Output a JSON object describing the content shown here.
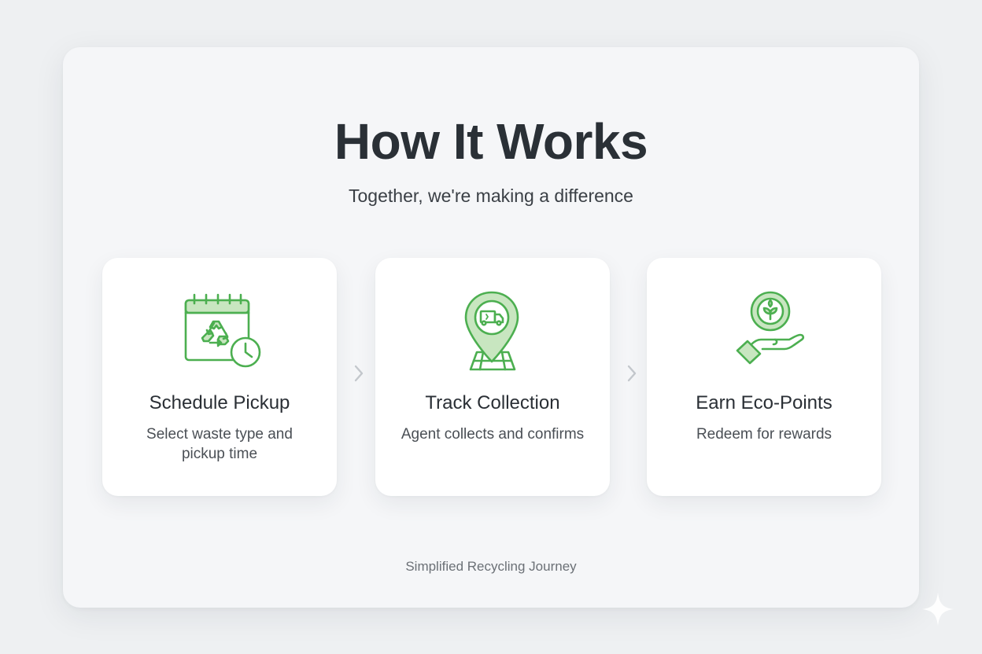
{
  "header": {
    "title": "How It Works",
    "subtitle": "Together, we're making a difference"
  },
  "steps": [
    {
      "title": "Schedule Pickup",
      "description": "Select waste type and pickup time",
      "icon": "calendar-recycle-clock-icon"
    },
    {
      "title": "Track Collection",
      "description": "Agent collects and confirms",
      "icon": "map-pin-truck-icon"
    },
    {
      "title": "Earn Eco-Points",
      "description": "Redeem for rewards",
      "icon": "hand-coin-leaf-icon"
    }
  ],
  "footer": {
    "text": "Simplified Recycling Journey"
  },
  "colors": {
    "accent": "#4caf50",
    "accent_light": "#c8e6c0",
    "title": "#2a3036",
    "background": "#eef0f2",
    "card": "#ffffff"
  }
}
